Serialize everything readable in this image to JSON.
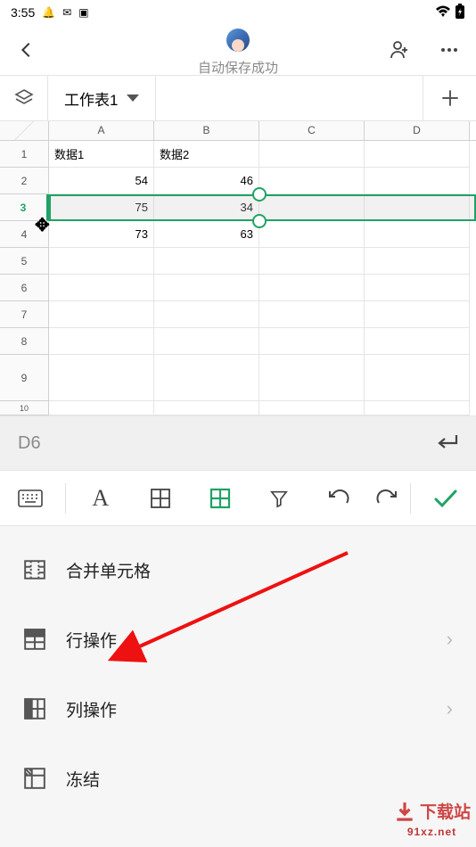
{
  "status": {
    "time": "3:55"
  },
  "header": {
    "title": "自动保存成功"
  },
  "sheet": {
    "tab_label": "工作表1"
  },
  "columns": [
    "A",
    "B",
    "C",
    "D"
  ],
  "rows": [
    "1",
    "2",
    "3",
    "4",
    "5",
    "6",
    "7",
    "8",
    "9",
    "10"
  ],
  "selected_row_index": 2,
  "cells": {
    "A1": "数据1",
    "B1": "数据2",
    "A2": "54",
    "B2": "46",
    "A3": "75",
    "B3": "34",
    "A4": "73",
    "B4": "63"
  },
  "formula_bar": {
    "cell_ref": "D6",
    "value": ""
  },
  "menu": {
    "merge": "合并单元格",
    "row_ops": "行操作",
    "col_ops": "列操作",
    "freeze": "冻结"
  },
  "watermark": {
    "line1": "下载站",
    "line2": "91xz.net"
  }
}
